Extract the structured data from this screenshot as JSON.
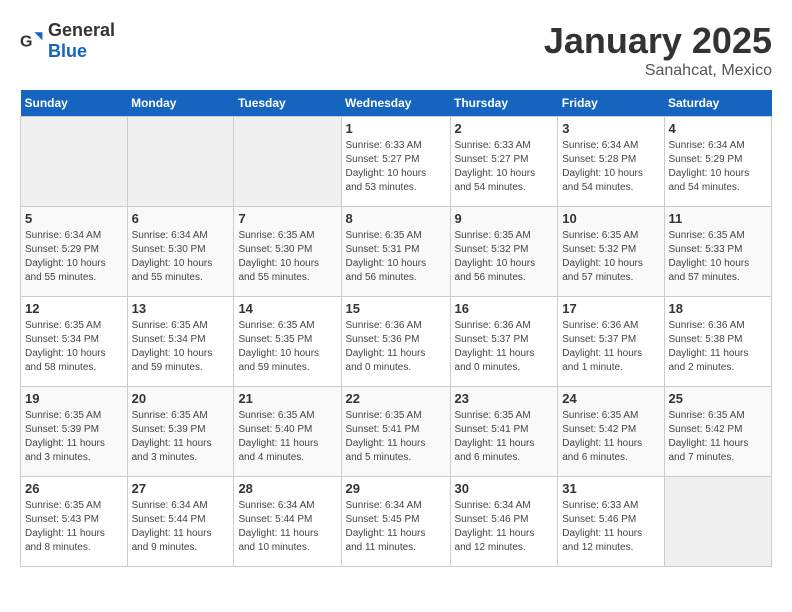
{
  "header": {
    "logo_general": "General",
    "logo_blue": "Blue",
    "title": "January 2025",
    "subtitle": "Sanahcat, Mexico"
  },
  "days_of_week": [
    "Sunday",
    "Monday",
    "Tuesday",
    "Wednesday",
    "Thursday",
    "Friday",
    "Saturday"
  ],
  "weeks": [
    [
      {
        "day": "",
        "info": ""
      },
      {
        "day": "",
        "info": ""
      },
      {
        "day": "",
        "info": ""
      },
      {
        "day": "1",
        "info": "Sunrise: 6:33 AM\nSunset: 5:27 PM\nDaylight: 10 hours\nand 53 minutes."
      },
      {
        "day": "2",
        "info": "Sunrise: 6:33 AM\nSunset: 5:27 PM\nDaylight: 10 hours\nand 54 minutes."
      },
      {
        "day": "3",
        "info": "Sunrise: 6:34 AM\nSunset: 5:28 PM\nDaylight: 10 hours\nand 54 minutes."
      },
      {
        "day": "4",
        "info": "Sunrise: 6:34 AM\nSunset: 5:29 PM\nDaylight: 10 hours\nand 54 minutes."
      }
    ],
    [
      {
        "day": "5",
        "info": "Sunrise: 6:34 AM\nSunset: 5:29 PM\nDaylight: 10 hours\nand 55 minutes."
      },
      {
        "day": "6",
        "info": "Sunrise: 6:34 AM\nSunset: 5:30 PM\nDaylight: 10 hours\nand 55 minutes."
      },
      {
        "day": "7",
        "info": "Sunrise: 6:35 AM\nSunset: 5:30 PM\nDaylight: 10 hours\nand 55 minutes."
      },
      {
        "day": "8",
        "info": "Sunrise: 6:35 AM\nSunset: 5:31 PM\nDaylight: 10 hours\nand 56 minutes."
      },
      {
        "day": "9",
        "info": "Sunrise: 6:35 AM\nSunset: 5:32 PM\nDaylight: 10 hours\nand 56 minutes."
      },
      {
        "day": "10",
        "info": "Sunrise: 6:35 AM\nSunset: 5:32 PM\nDaylight: 10 hours\nand 57 minutes."
      },
      {
        "day": "11",
        "info": "Sunrise: 6:35 AM\nSunset: 5:33 PM\nDaylight: 10 hours\nand 57 minutes."
      }
    ],
    [
      {
        "day": "12",
        "info": "Sunrise: 6:35 AM\nSunset: 5:34 PM\nDaylight: 10 hours\nand 58 minutes."
      },
      {
        "day": "13",
        "info": "Sunrise: 6:35 AM\nSunset: 5:34 PM\nDaylight: 10 hours\nand 59 minutes."
      },
      {
        "day": "14",
        "info": "Sunrise: 6:35 AM\nSunset: 5:35 PM\nDaylight: 10 hours\nand 59 minutes."
      },
      {
        "day": "15",
        "info": "Sunrise: 6:36 AM\nSunset: 5:36 PM\nDaylight: 11 hours\nand 0 minutes."
      },
      {
        "day": "16",
        "info": "Sunrise: 6:36 AM\nSunset: 5:37 PM\nDaylight: 11 hours\nand 0 minutes."
      },
      {
        "day": "17",
        "info": "Sunrise: 6:36 AM\nSunset: 5:37 PM\nDaylight: 11 hours\nand 1 minute."
      },
      {
        "day": "18",
        "info": "Sunrise: 6:36 AM\nSunset: 5:38 PM\nDaylight: 11 hours\nand 2 minutes."
      }
    ],
    [
      {
        "day": "19",
        "info": "Sunrise: 6:35 AM\nSunset: 5:39 PM\nDaylight: 11 hours\nand 3 minutes."
      },
      {
        "day": "20",
        "info": "Sunrise: 6:35 AM\nSunset: 5:39 PM\nDaylight: 11 hours\nand 3 minutes."
      },
      {
        "day": "21",
        "info": "Sunrise: 6:35 AM\nSunset: 5:40 PM\nDaylight: 11 hours\nand 4 minutes."
      },
      {
        "day": "22",
        "info": "Sunrise: 6:35 AM\nSunset: 5:41 PM\nDaylight: 11 hours\nand 5 minutes."
      },
      {
        "day": "23",
        "info": "Sunrise: 6:35 AM\nSunset: 5:41 PM\nDaylight: 11 hours\nand 6 minutes."
      },
      {
        "day": "24",
        "info": "Sunrise: 6:35 AM\nSunset: 5:42 PM\nDaylight: 11 hours\nand 6 minutes."
      },
      {
        "day": "25",
        "info": "Sunrise: 6:35 AM\nSunset: 5:42 PM\nDaylight: 11 hours\nand 7 minutes."
      }
    ],
    [
      {
        "day": "26",
        "info": "Sunrise: 6:35 AM\nSunset: 5:43 PM\nDaylight: 11 hours\nand 8 minutes."
      },
      {
        "day": "27",
        "info": "Sunrise: 6:34 AM\nSunset: 5:44 PM\nDaylight: 11 hours\nand 9 minutes."
      },
      {
        "day": "28",
        "info": "Sunrise: 6:34 AM\nSunset: 5:44 PM\nDaylight: 11 hours\nand 10 minutes."
      },
      {
        "day": "29",
        "info": "Sunrise: 6:34 AM\nSunset: 5:45 PM\nDaylight: 11 hours\nand 11 minutes."
      },
      {
        "day": "30",
        "info": "Sunrise: 6:34 AM\nSunset: 5:46 PM\nDaylight: 11 hours\nand 12 minutes."
      },
      {
        "day": "31",
        "info": "Sunrise: 6:33 AM\nSunset: 5:46 PM\nDaylight: 11 hours\nand 12 minutes."
      },
      {
        "day": "",
        "info": ""
      }
    ]
  ]
}
